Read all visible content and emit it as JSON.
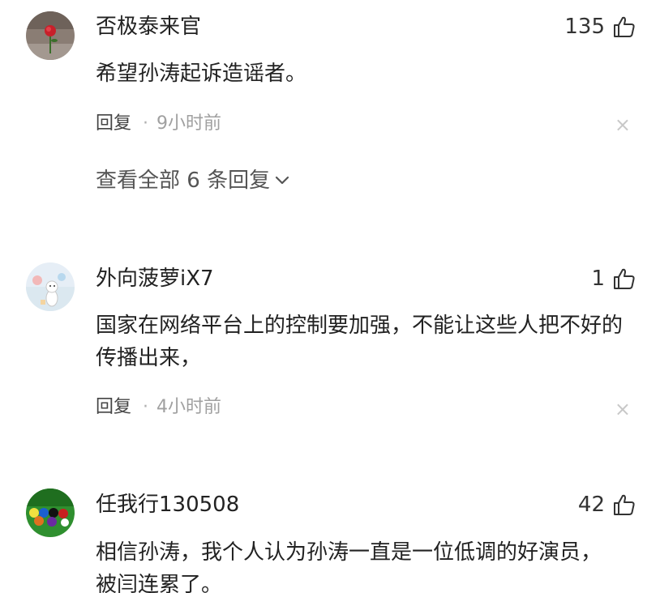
{
  "comments": [
    {
      "username": "否极泰来官",
      "likes": "135",
      "text": "希望孙涛起诉造谣者。",
      "reply_label": "回复",
      "separator": "·",
      "time": "9小时前",
      "close": "×",
      "view_all": "查看全部 6 条回复",
      "avatar_icon": "rose-avatar"
    },
    {
      "username": "外向菠萝iX7",
      "likes": "1",
      "text": "国家在网络平台上的控制要加强，不能让这些人把不好的传播出来，",
      "reply_label": "回复",
      "separator": "·",
      "time": "4小时前",
      "close": "×",
      "avatar_icon": "cartoon-avatar"
    },
    {
      "username": "任我行130508",
      "likes": "42",
      "text": "相信孙涛，我个人认为孙涛一直是一位低调的好演员，被闫连累了。",
      "avatar_icon": "billiards-avatar"
    }
  ],
  "colors": {
    "text": "#222222",
    "muted": "#a0a0a0",
    "close": "#c8c8c8"
  }
}
